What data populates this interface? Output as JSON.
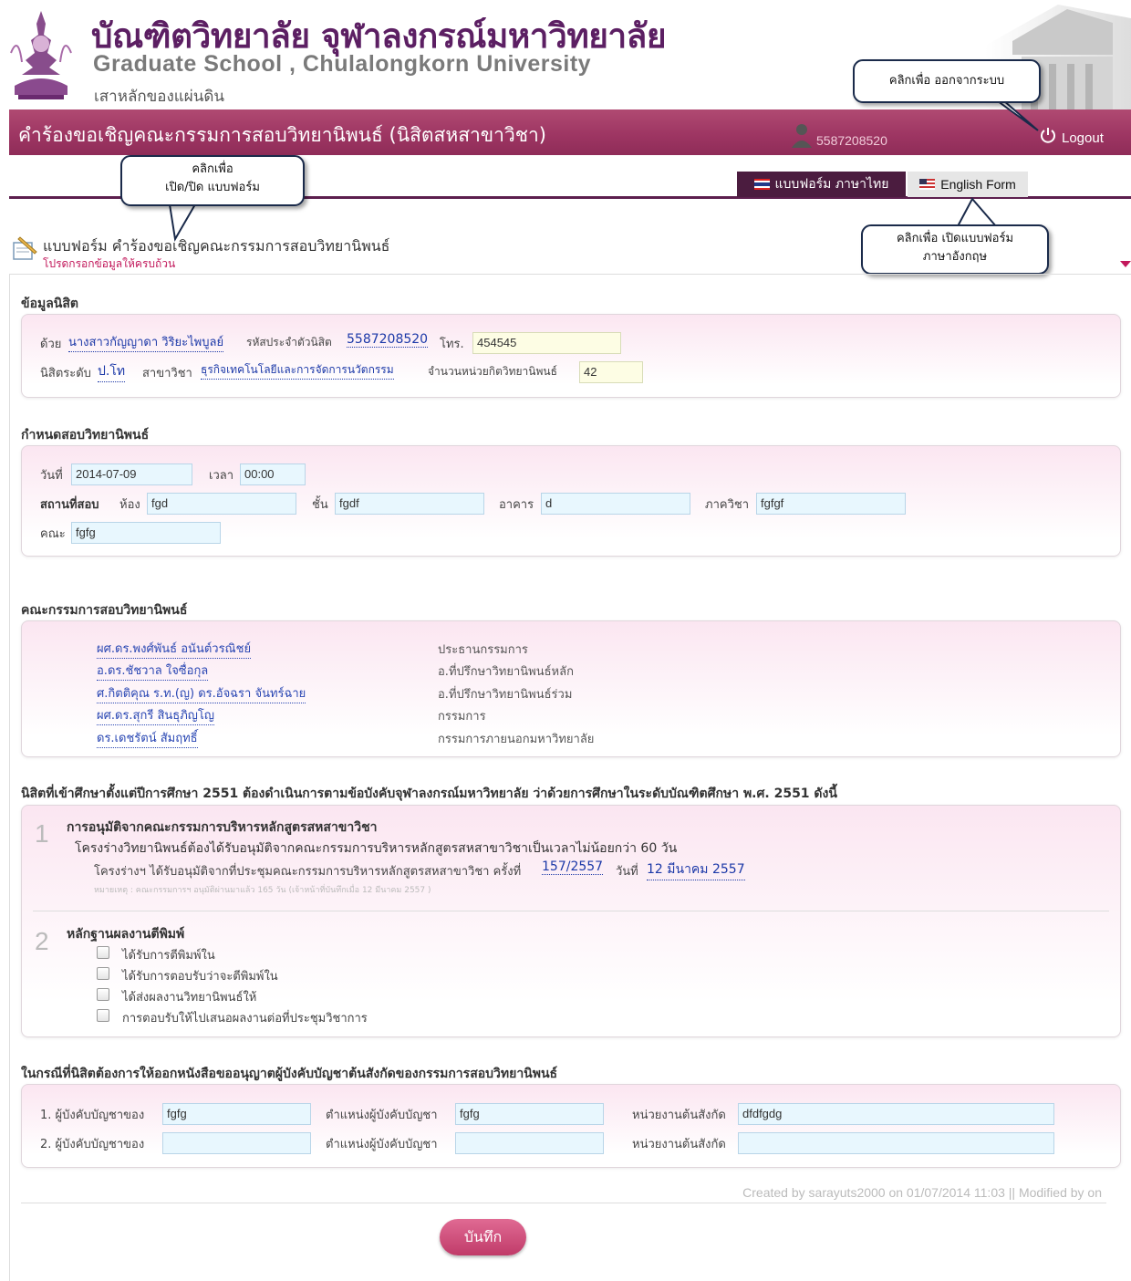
{
  "header": {
    "title_th": "บัณฑิตวิทยาลัย จุฬาลงกรณ์มหาวิทยาลัย",
    "title_en": "Graduate School , Chulalongkorn University",
    "slogan": "เสาหลักของแผ่นดิน",
    "page_title": "คำร้องขอเชิญคณะกรรมการสอบวิทยานิพนธ์ (นิสิตสหสาขาวิชา)",
    "user_id": "5587208520",
    "logout_label": "Logout"
  },
  "tabs": {
    "thai_form": "แบบฟอร์ม ภาษาไทย",
    "english_form": "English Form"
  },
  "callouts": {
    "logout": "คลิกเพื่อ ออกจากระบบ",
    "toggle_line1": "คลิกเพื่อ",
    "toggle_line2": "เปิด/ปิด แบบฟอร์ม",
    "english_line1": "คลิกเพื่อ เปิดแบบฟอร์ม",
    "english_line2": "ภาษาอังกฤษ"
  },
  "form": {
    "title": "แบบฟอร์ม คำร้องขอเชิญคณะกรรมการสอบวิทยานิพนธ์",
    "hint": "โปรดกรอกข้อมูลให้ครบถ้วน"
  },
  "student": {
    "heading": "ข้อมูลนิสิต",
    "by_label": "ด้วย",
    "name": "นางสาวกัญญาดา วิริยะไพบูลย์",
    "id_label": "รหัสประจำตัวนิสิต",
    "id": "5587208520",
    "phone_label": "โทร.",
    "phone": "454545",
    "level_label": "นิสิตระดับ",
    "level": "ป.โท",
    "program_label": "สาขาวิชา",
    "program": "ธุรกิจเทคโนโลยีและการจัดการนวัตกรรม",
    "credits_label": "จำนวนหน่วยกิตวิทยานิพนธ์",
    "credits": "42"
  },
  "exam": {
    "heading": "กำหนดสอบวิทยานิพนธ์",
    "date_label": "วันที่",
    "date": "2014-07-09",
    "time_label": "เวลา",
    "time": "00:00",
    "place_label": "สถานที่สอบ",
    "room_label": "ห้อง",
    "room": "fgd",
    "floor_label": "ชั้น",
    "floor": "fgdf",
    "building_label": "อาคาร",
    "building": "d",
    "dept_label": "ภาควิชา",
    "dept": "fgfgf",
    "faculty_label": "คณะ",
    "faculty": "fgfg"
  },
  "committee": {
    "heading": "คณะกรรมการสอบวิทยานิพนธ์",
    "members": [
      {
        "name": "ผศ.ดร.พงศ์พันธ์ อนันต์วรณิชย์",
        "role": "ประธานกรรมการ"
      },
      {
        "name": "อ.ดร.ชัชวาล ใจซื่อกุล",
        "role": "อ.ที่ปรึกษาวิทยานิพนธ์หลัก"
      },
      {
        "name": "ศ.กิตติคุณ ร.ท.(ญ) ดร.อัจฉรา จันทร์ฉาย",
        "role": "อ.ที่ปรึกษาวิทยานิพนธ์ร่วม"
      },
      {
        "name": "ผศ.ดร.สุกรี สินธุภิญโญ",
        "role": "กรรมการ"
      },
      {
        "name": "ดร.เดชรัตน์ สัมฤทธิ์",
        "role": "กรรมการภายนอกมหาวิทยาลัย"
      }
    ]
  },
  "requirements": {
    "heading": "นิสิตที่เข้าศึกษาตั้งแต่ปีการศึกษา 2551 ต้องดำเนินการตามข้อบังคับจุฬาลงกรณ์มหาวิทยาลัย ว่าด้วยการศึกษาในระดับบัณฑิตศึกษา พ.ศ. 2551 ดังนี้",
    "item1": {
      "num": "1",
      "title": "การอนุมัติจากคณะกรรมการบริหารหลักสูตรสหสาขาวิชา",
      "desc": "โครงร่างวิทยานิพนธ์ต้องได้รับอนุมัติจากคณะกรรมการบริหารหลักสูตรสหสาขาวิชาเป็นเวลาไม่น้อยกว่า 60 วัน",
      "approval_label": "โครงร่างฯ ได้รับอนุมัติจากที่ประชุมคณะกรรมการบริหารหลักสูตรสหสาขาวิชา ครั้งที่",
      "meeting_no": "157/2557",
      "date_label": "วันที่",
      "date": "12 มีนาคม 2557",
      "note": "หมายเหตุ : คณะกรรมการฯ อนุมัติผ่านมาแล้ว 165 วัน (เจ้าหน้าที่บันทึกเมื่อ 12 มีนาคม 2557 )"
    },
    "item2": {
      "num": "2",
      "title": "หลักฐานผลงานตีพิมพ์",
      "options": [
        "ได้รับการตีพิมพ์ใน",
        "ได้รับการตอบรับว่าจะตีพิมพ์ใน",
        "ได้ส่งผลงานวิทยานิพนธ์ให้",
        "การตอบรับให้ไปเสนอผลงานต่อที่ประชุมวิชาการ"
      ]
    }
  },
  "supervisors": {
    "heading": "ในกรณีที่นิสิตต้องการให้ออกหนังสือขออนุญาตผู้บังคับบัญชาต้นสังกัดของกรรมการสอบวิทยานิพนธ์",
    "rows": [
      {
        "label": "1. ผู้บังคับบัญชาของ",
        "name": "fgfg",
        "pos_label": "ตำแหน่งผู้บังคับบัญชา",
        "pos": "fgfg",
        "unit_label": "หน่วยงานต้นสังกัด",
        "unit": "dfdfgdg"
      },
      {
        "label": "2. ผู้บังคับบัญชาของ",
        "name": "",
        "pos_label": "ตำแหน่งผู้บังคับบัญชา",
        "pos": "",
        "unit_label": "หน่วยงานต้นสังกัด",
        "unit": ""
      }
    ]
  },
  "footer": {
    "note": "Created by sarayuts2000 on 01/07/2014 11:03 || Modified by on",
    "save_label": "บันทึก"
  },
  "colors": {
    "brand_purple": "#5c1f63",
    "header_bar": "#9e3663",
    "link_blue": "#1c39a8",
    "input_bg": "#e8f7fe",
    "save_button": "#d0517e"
  }
}
